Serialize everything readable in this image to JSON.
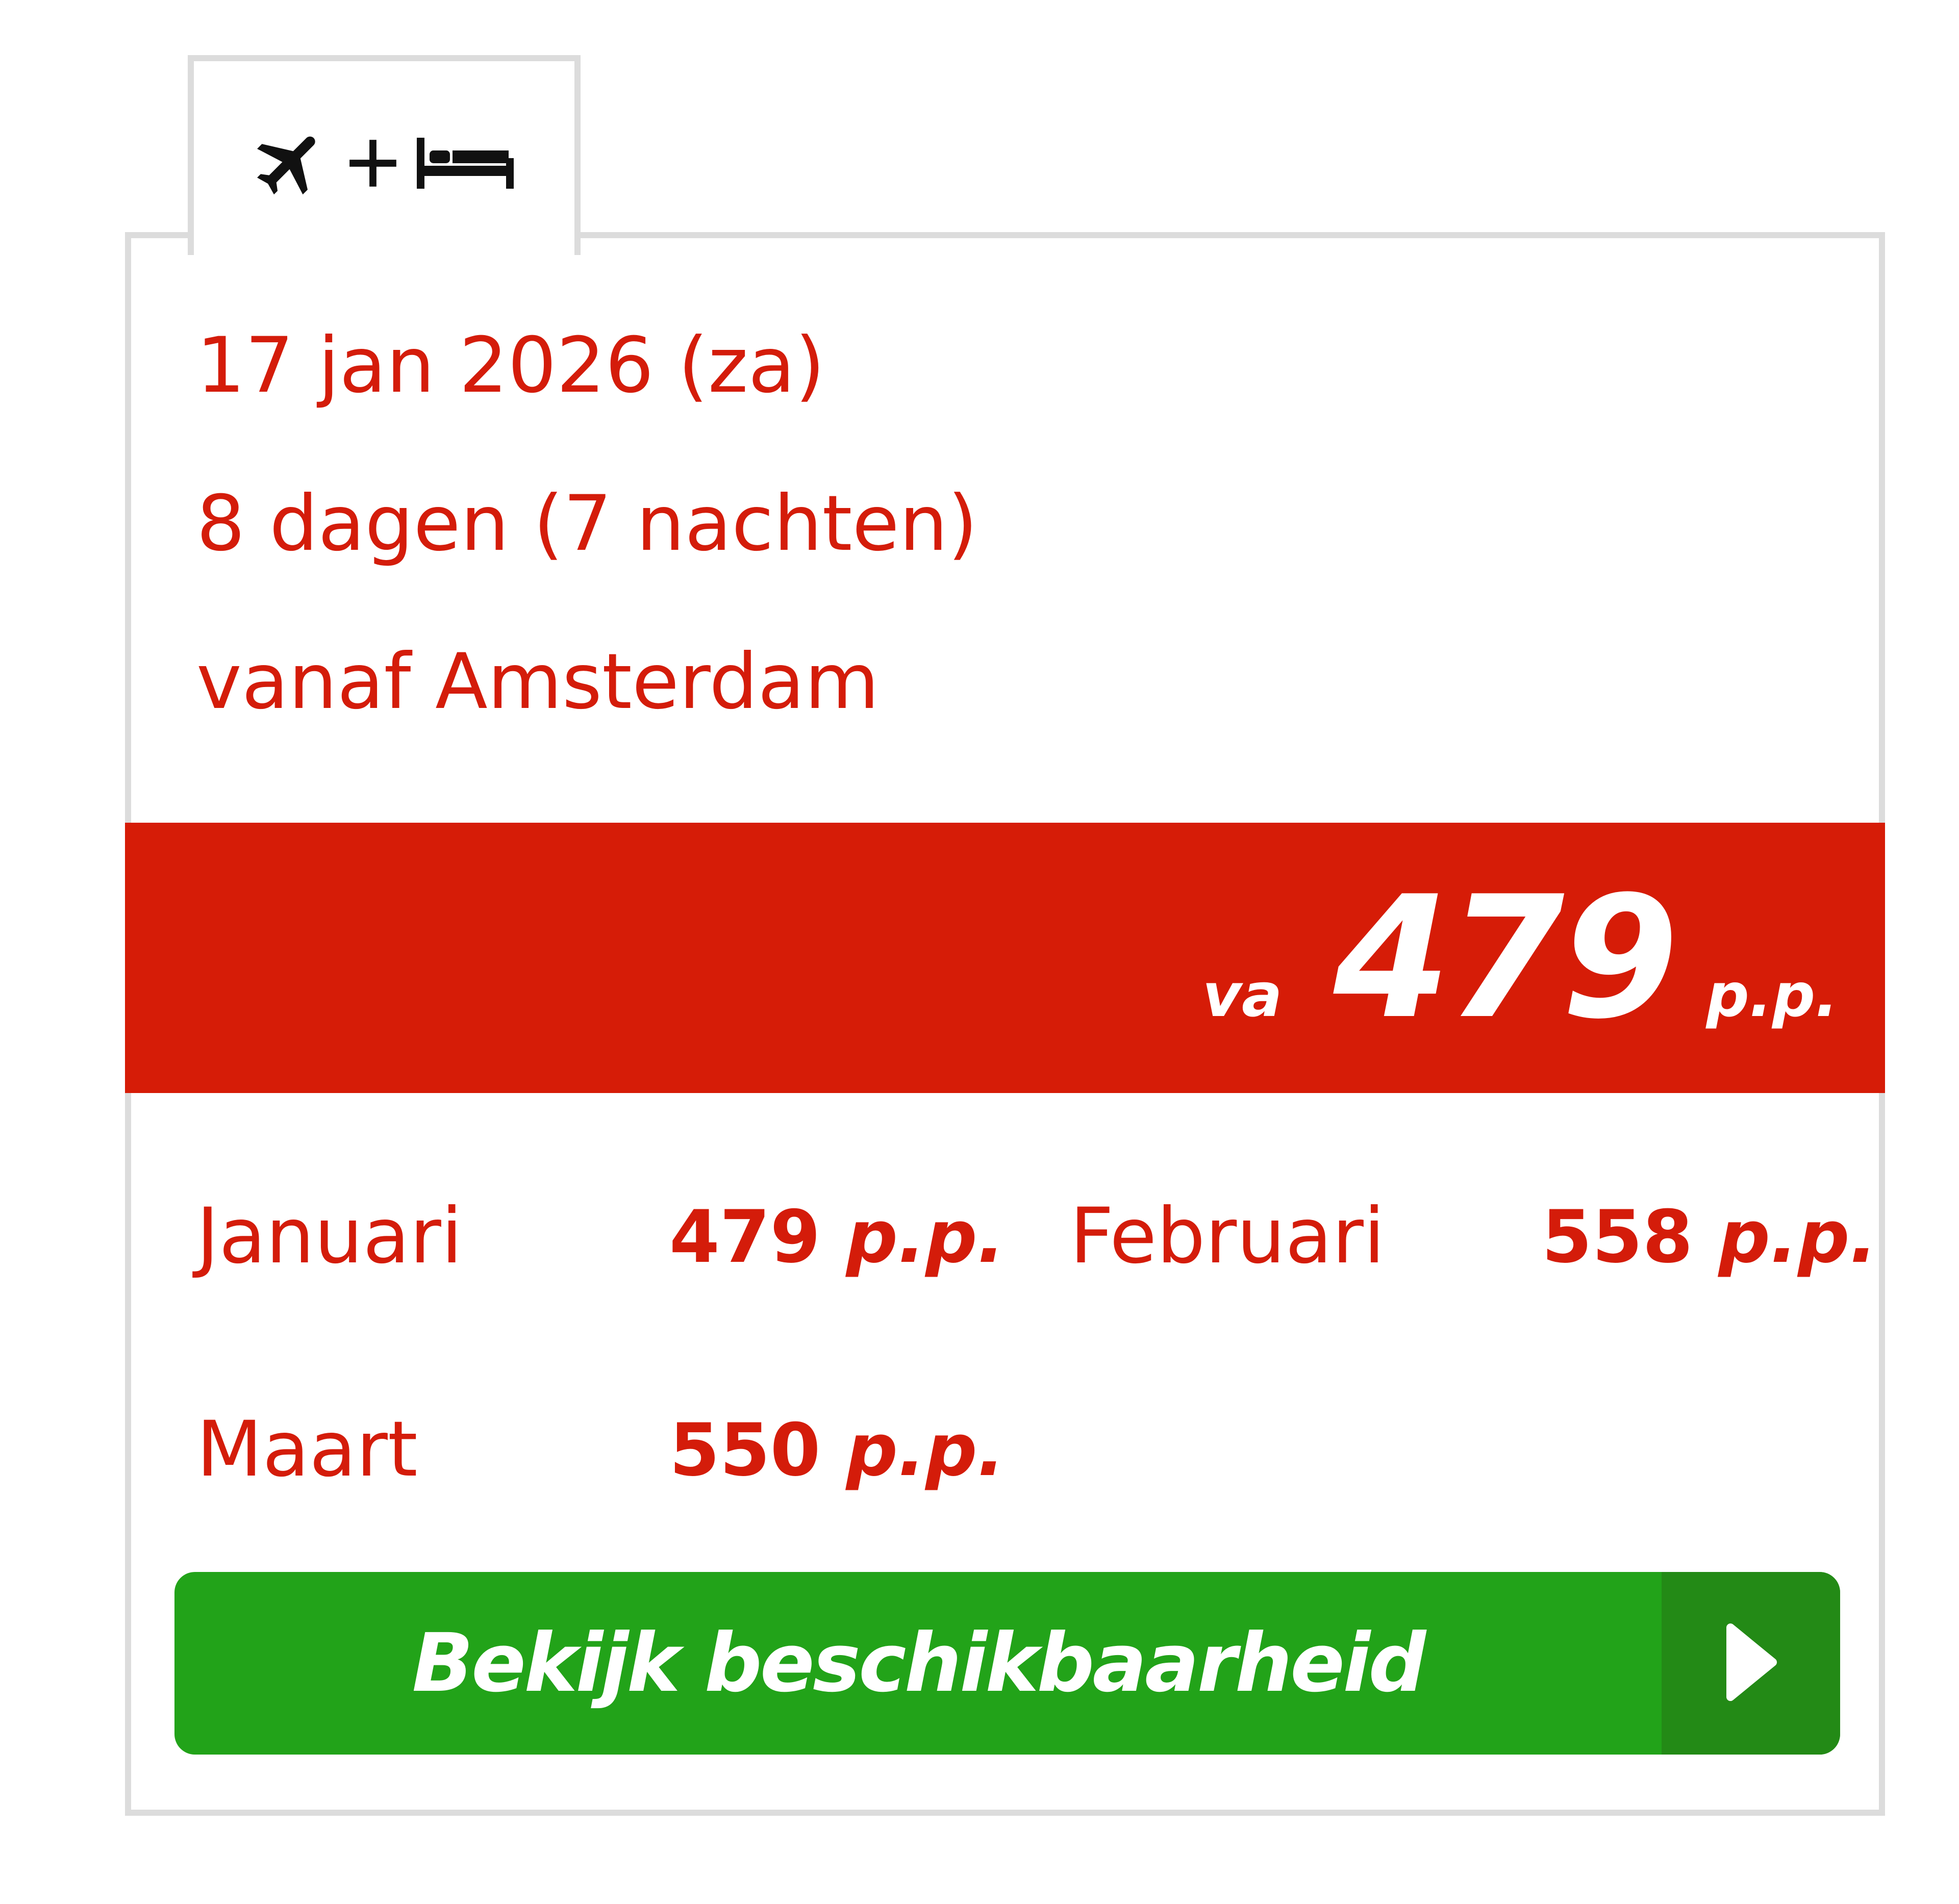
{
  "tab": {
    "icons": [
      "airplane-icon",
      "plus-icon",
      "bed-icon"
    ]
  },
  "info": {
    "date": "17 jan 2026 (za)",
    "duration": "8 dagen (7 nachten)",
    "departure": "vanaf Amsterdam"
  },
  "price": {
    "prefix": "va",
    "amount": "479",
    "suffix": "p.p."
  },
  "months": [
    {
      "label": "Januari",
      "price": "479",
      "unit": "p.p."
    },
    {
      "label": "Februari",
      "price": "558",
      "unit": "p.p."
    },
    {
      "label": "Maart",
      "price": "550",
      "unit": "p.p."
    }
  ],
  "cta": {
    "label": "Bekijk beschikbaarheid",
    "icon": "play-arrow-icon"
  },
  "colors": {
    "accent_red": "#d61c07",
    "text_red": "#d41c0a",
    "button_green": "#22a319",
    "button_green_dark": "#238a16",
    "border_gray": "#dcdcdc"
  }
}
